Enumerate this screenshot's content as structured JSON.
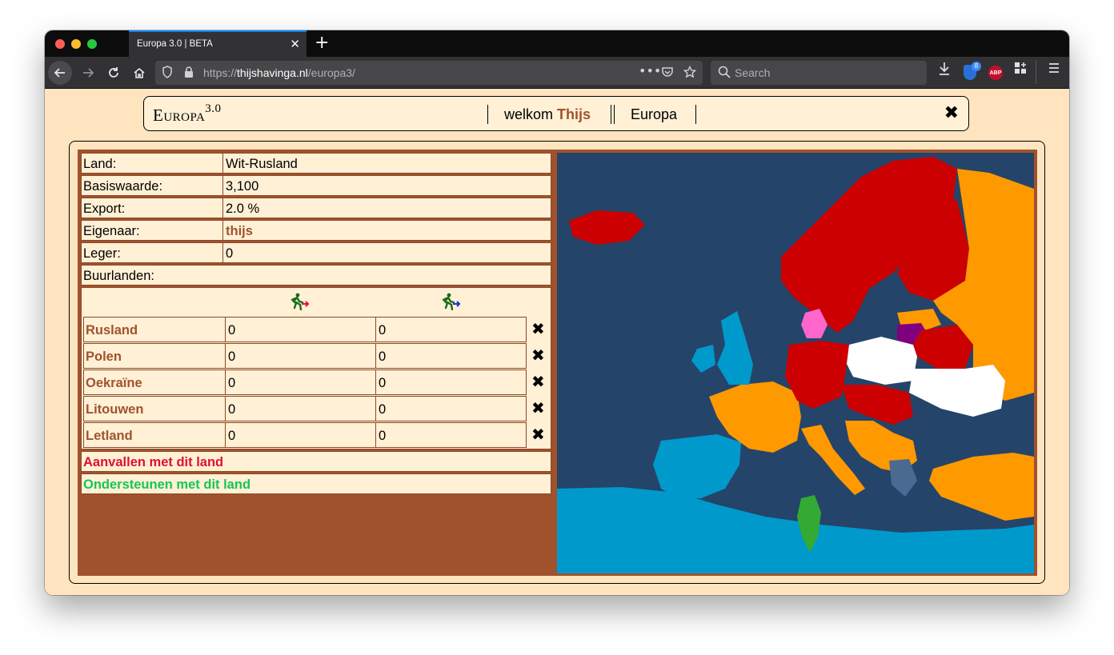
{
  "browser": {
    "tab_title": "Europa 3.0 | BETA",
    "url_prefix": "https://",
    "url_host": "thijshavinga.nl",
    "url_path": "/europa3/",
    "search_placeholder": "Search",
    "ublock_badge": "8",
    "abp_label": "ABP"
  },
  "header": {
    "logo_main": "Europa",
    "logo_sup": "3.0",
    "welcome_prefix": "welkom",
    "username": "Thijs",
    "map_name": "Europa"
  },
  "country": {
    "rows": [
      {
        "label": "Land:",
        "value": "Wit-Rusland"
      },
      {
        "label": "Basiswaarde:",
        "value": "3,100"
      },
      {
        "label": "Export:",
        "value": "2.0 %"
      },
      {
        "label": "Eigenaar:",
        "value": "thijs"
      },
      {
        "label": "Leger:",
        "value": "0"
      }
    ],
    "neighbors_label": "Buurlanden:",
    "neighbors": [
      {
        "name": "Rusland",
        "v1": "0",
        "v2": "0"
      },
      {
        "name": "Polen",
        "v1": "0",
        "v2": "0"
      },
      {
        "name": "Oekraïne",
        "v1": "0",
        "v2": "0"
      },
      {
        "name": "Litouwen",
        "v1": "0",
        "v2": "0"
      },
      {
        "name": "Letland",
        "v1": "0",
        "v2": "0"
      }
    ],
    "attack_label": "Aanvallen met dit land",
    "support_label": "Ondersteunen met dit land"
  },
  "colors": {
    "panel": "#a0522d",
    "sea": "#254469",
    "owner_red": "#cc0000",
    "orange": "#ff9900",
    "blue": "#0099cc",
    "white": "#ffffff",
    "purple": "#800080",
    "pink": "#ff66cc",
    "green": "#33aa33",
    "attack": "#e0102f",
    "support": "#17c653"
  }
}
